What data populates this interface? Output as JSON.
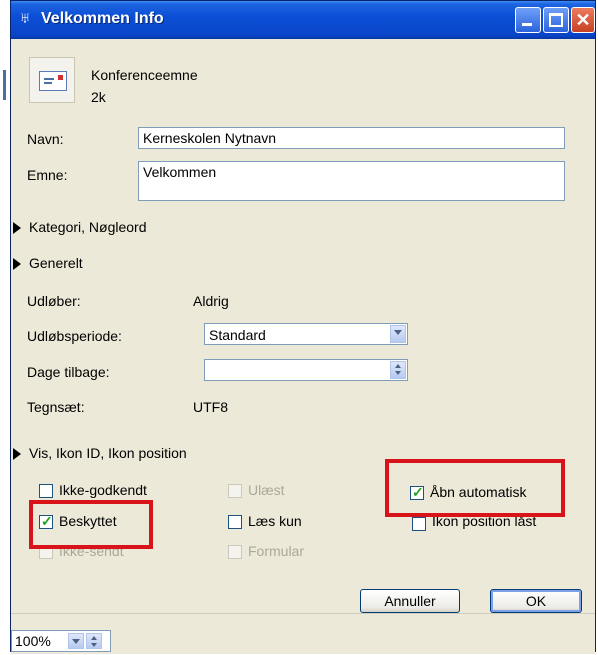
{
  "window": {
    "title": "Velkommen Info",
    "title_icon": "snail-icon"
  },
  "header": {
    "item_type": "Konferenceemne",
    "size": "2k",
    "icon": "conference-item-icon"
  },
  "fields": {
    "name_label": "Navn:",
    "name_value": "Kerneskolen Nytnavn",
    "subject_label": "Emne:",
    "subject_value": "Velkommen"
  },
  "sections": {
    "category": "Kategori, Nøgleord",
    "general": "Generelt",
    "view": "Vis, Ikon ID, Ikon position"
  },
  "general": {
    "expires_label": "Udløber:",
    "expires_value": "Aldrig",
    "expiry_period_label": "Udløbsperiode:",
    "expiry_period_value": "Standard",
    "days_back_label": "Dage tilbage:",
    "days_back_value": "",
    "charset_label": "Tegnsæt:",
    "charset_value": "UTF8"
  },
  "checkboxes": [
    {
      "label": "Ikke-godkendt",
      "checked": false,
      "enabled": true
    },
    {
      "label": "Ulæst",
      "checked": false,
      "enabled": false
    },
    {
      "label": "Åbn automatisk",
      "checked": true,
      "enabled": true
    },
    {
      "label": "Beskyttet",
      "checked": true,
      "enabled": true
    },
    {
      "label": "Læs kun",
      "checked": false,
      "enabled": true
    },
    {
      "label": "Ikon position låst",
      "checked": false,
      "enabled": true
    },
    {
      "label": "Ikke-sendt",
      "checked": false,
      "enabled": false
    },
    {
      "label": "Formular",
      "checked": false,
      "enabled": false
    }
  ],
  "buttons": {
    "cancel": "Annuller",
    "ok": "OK"
  },
  "status": {
    "zoom": "100%"
  },
  "colors": {
    "highlight": "#d8141a",
    "titlebar": "#0b4fd6",
    "check": "#21a121"
  }
}
